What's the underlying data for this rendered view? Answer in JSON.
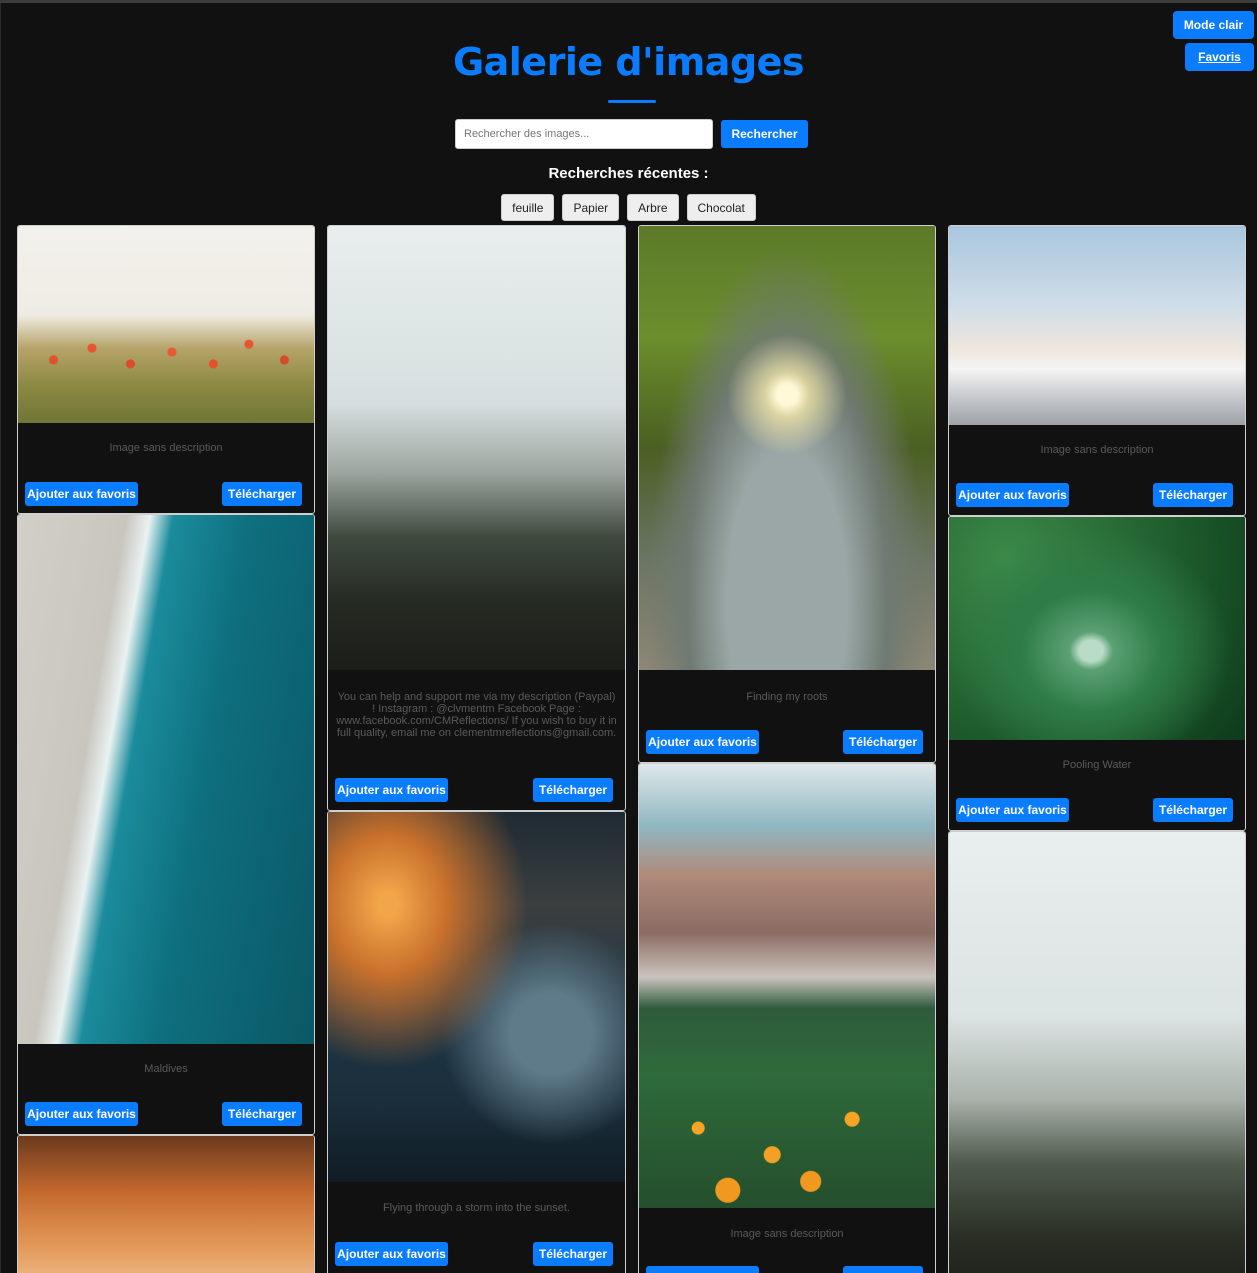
{
  "header": {
    "title": "Galerie d'images",
    "mode_button": "Mode clair",
    "favorites_button": "Favoris"
  },
  "search": {
    "placeholder": "Rechercher des images...",
    "button": "Rechercher"
  },
  "recent": {
    "title": "Recherches récentes :",
    "items": [
      "feuille",
      "Papier",
      "Arbre",
      "Chocolat"
    ]
  },
  "card_actions": {
    "favorite": "Ajouter aux favoris",
    "download": "Télécharger"
  },
  "cards": [
    {
      "description": "Image sans description",
      "subject": "poppy-field"
    },
    {
      "description": "You can help and support me via my description (Paypal) ! Instagram : @clvmentm Facebook Page : www.facebook.com/CMReflections/ If you wish to buy it in full quality, email me on clementmreflections@gmail.com.",
      "subject": "foggy-forest"
    },
    {
      "description": "Finding my roots",
      "subject": "big-tree"
    },
    {
      "description": "Image sans description",
      "subject": "sky-above-clouds"
    },
    {
      "description": "Maldives",
      "subject": "aerial-beach"
    },
    {
      "description": "Flying through a storm into the sunset.",
      "subject": "storm-clouds"
    },
    {
      "description": "Pooling Water",
      "subject": "water-drop-leaf"
    },
    {
      "description": "Image sans description",
      "subject": "mountain-flowers"
    },
    {
      "description": "",
      "subject": "autumn-trees"
    },
    {
      "description": "",
      "subject": "foggy-forest"
    }
  ],
  "colors": {
    "accent": "#0a7cff",
    "background": "#111111",
    "card_border": "#cfcfcf",
    "description_text": "#5a5a5a"
  }
}
